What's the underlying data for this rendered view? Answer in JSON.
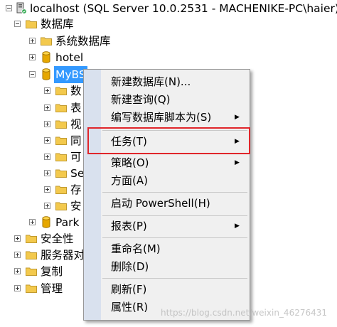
{
  "tree": {
    "root": "localhost (SQL Server 10.0.2531 - MACHENIKE-PC\\haier)",
    "databases": "数据库",
    "system_databases": "系统数据库",
    "hotel": "hotel",
    "mybs": "MyBS",
    "mybs_children": [
      "数",
      "表",
      "视",
      "同",
      "可",
      "Se",
      "存",
      "安"
    ],
    "park": "Park",
    "security": "安全性",
    "server_objects": "服务器对",
    "replication": "复制",
    "management": "管理"
  },
  "context_menu": {
    "items": [
      {
        "label": "新建数据库(N)...",
        "submenu": false
      },
      {
        "label": "新建查询(Q)",
        "submenu": false
      },
      {
        "label": "编写数据库脚本为(S)",
        "submenu": true
      },
      {
        "label": "任务(T)",
        "submenu": true
      },
      {
        "label": "策略(O)",
        "submenu": true
      },
      {
        "label": "方面(A)",
        "submenu": false
      },
      {
        "label": "启动 PowerShell(H)",
        "submenu": false
      },
      {
        "label": "报表(P)",
        "submenu": true
      },
      {
        "label": "重命名(M)",
        "submenu": false
      },
      {
        "label": "删除(D)",
        "submenu": false
      },
      {
        "label": "刷新(F)",
        "submenu": false
      },
      {
        "label": "属性(R)",
        "submenu": false
      }
    ],
    "arrow_glyph": "▶"
  },
  "watermark": "https://blog.csdn.net/weixin_46276431",
  "colors": {
    "selection": "#3399ff",
    "highlight_box": "#e0262b",
    "folder": "#f3c94d",
    "database": "#e6a700",
    "menu_bg": "#f0f0f0",
    "menu_gutter": "#d9e1ee"
  }
}
